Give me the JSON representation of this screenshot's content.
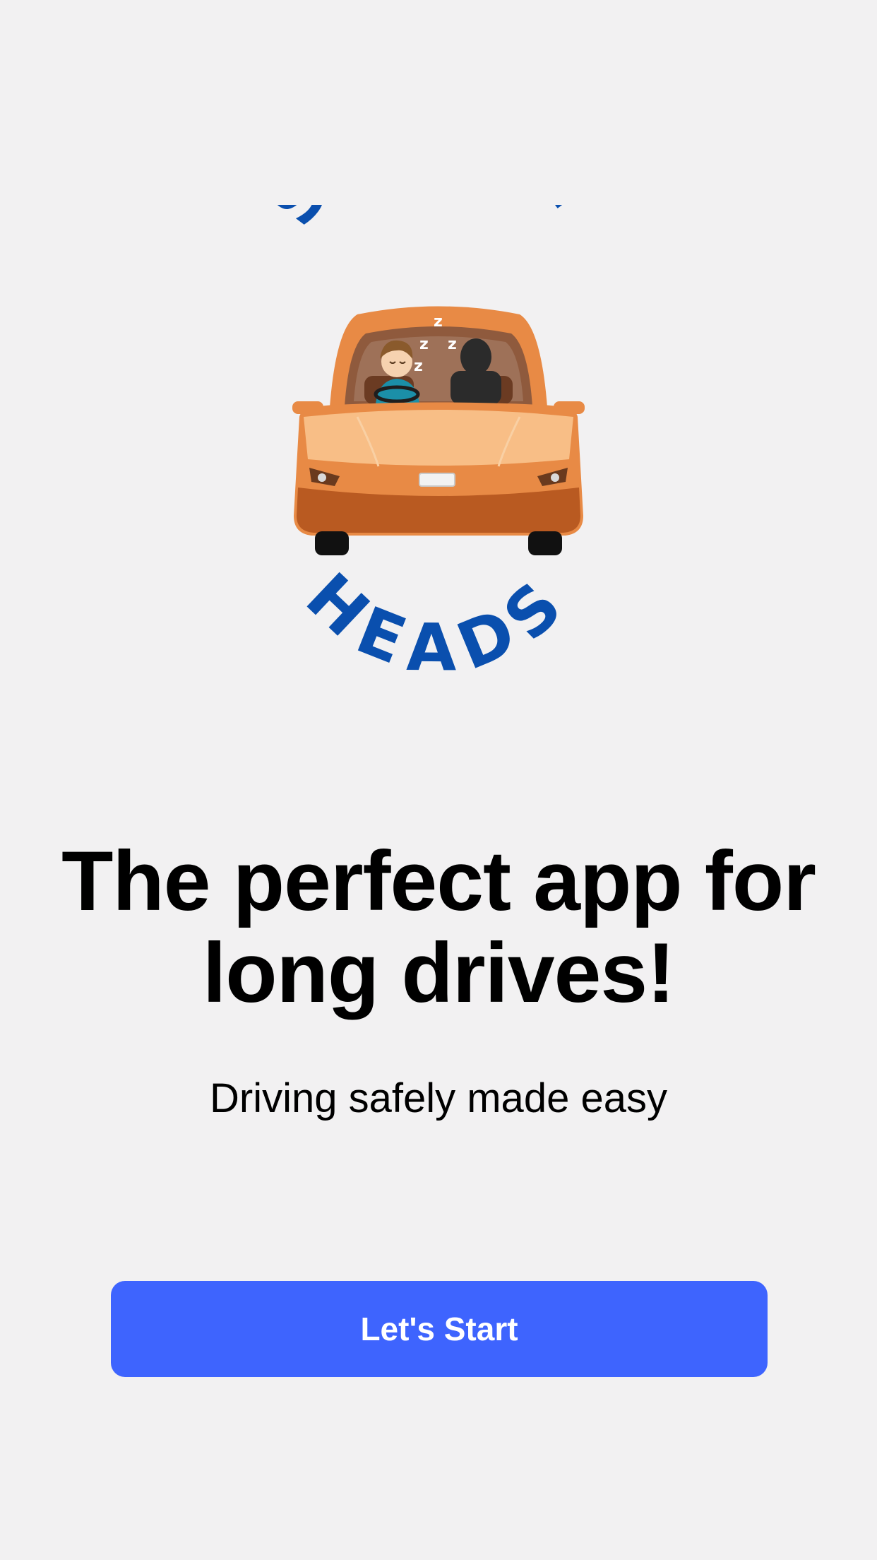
{
  "logo": {
    "text_top": "SLEEPY",
    "text_bottom": "HEADS",
    "snore_letters": [
      "z",
      "z",
      "z",
      "z"
    ],
    "icon": "sleeping-driver-car-icon",
    "colors": {
      "lettering": "#0a4fae",
      "car_body": "#e88a45",
      "car_hood": "#f8be86",
      "car_lower": "#b95a21"
    }
  },
  "headline": {
    "line1": "The perfect app for",
    "line2": "long drives!"
  },
  "subtitle": "Driving safely made easy",
  "start_button": {
    "label": "Let's Start",
    "color": "#3e64fe"
  },
  "background_color": "#f2f1f2"
}
